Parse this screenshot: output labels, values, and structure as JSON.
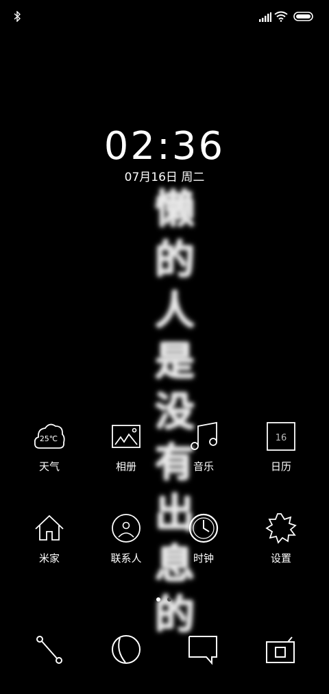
{
  "status_bar": {
    "bluetooth_icon": "bluetooth-icon",
    "signal_icon": "signal-icon",
    "wifi_icon": "wifi-icon",
    "battery_icon": "battery-icon"
  },
  "lock_clock": {
    "time": "02:36",
    "date": "07月16日 周二"
  },
  "wallpaper": {
    "calligraphy": [
      "懒",
      "的",
      "人",
      "是",
      "没",
      "有",
      "出",
      "息",
      "的"
    ]
  },
  "apps_row1": [
    {
      "label": "天气",
      "icon": "weather-icon",
      "temp": "25℃"
    },
    {
      "label": "相册",
      "icon": "gallery-icon"
    },
    {
      "label": "音乐",
      "icon": "music-icon"
    },
    {
      "label": "日历",
      "icon": "calendar-icon",
      "day": "16"
    }
  ],
  "apps_row2": [
    {
      "label": "米家",
      "icon": "mihome-icon"
    },
    {
      "label": "联系人",
      "icon": "contacts-icon"
    },
    {
      "label": "时钟",
      "icon": "clock-icon"
    },
    {
      "label": "设置",
      "icon": "settings-icon"
    }
  ],
  "page_indicator": {
    "pages": 2,
    "current": 1
  },
  "dock": [
    {
      "icon": "phone-icon"
    },
    {
      "icon": "browser-icon"
    },
    {
      "icon": "messages-icon"
    },
    {
      "icon": "camera-icon"
    }
  ],
  "colors": {
    "background": "#000000",
    "foreground": "#ffffff",
    "dot_inactive": "#555555"
  }
}
